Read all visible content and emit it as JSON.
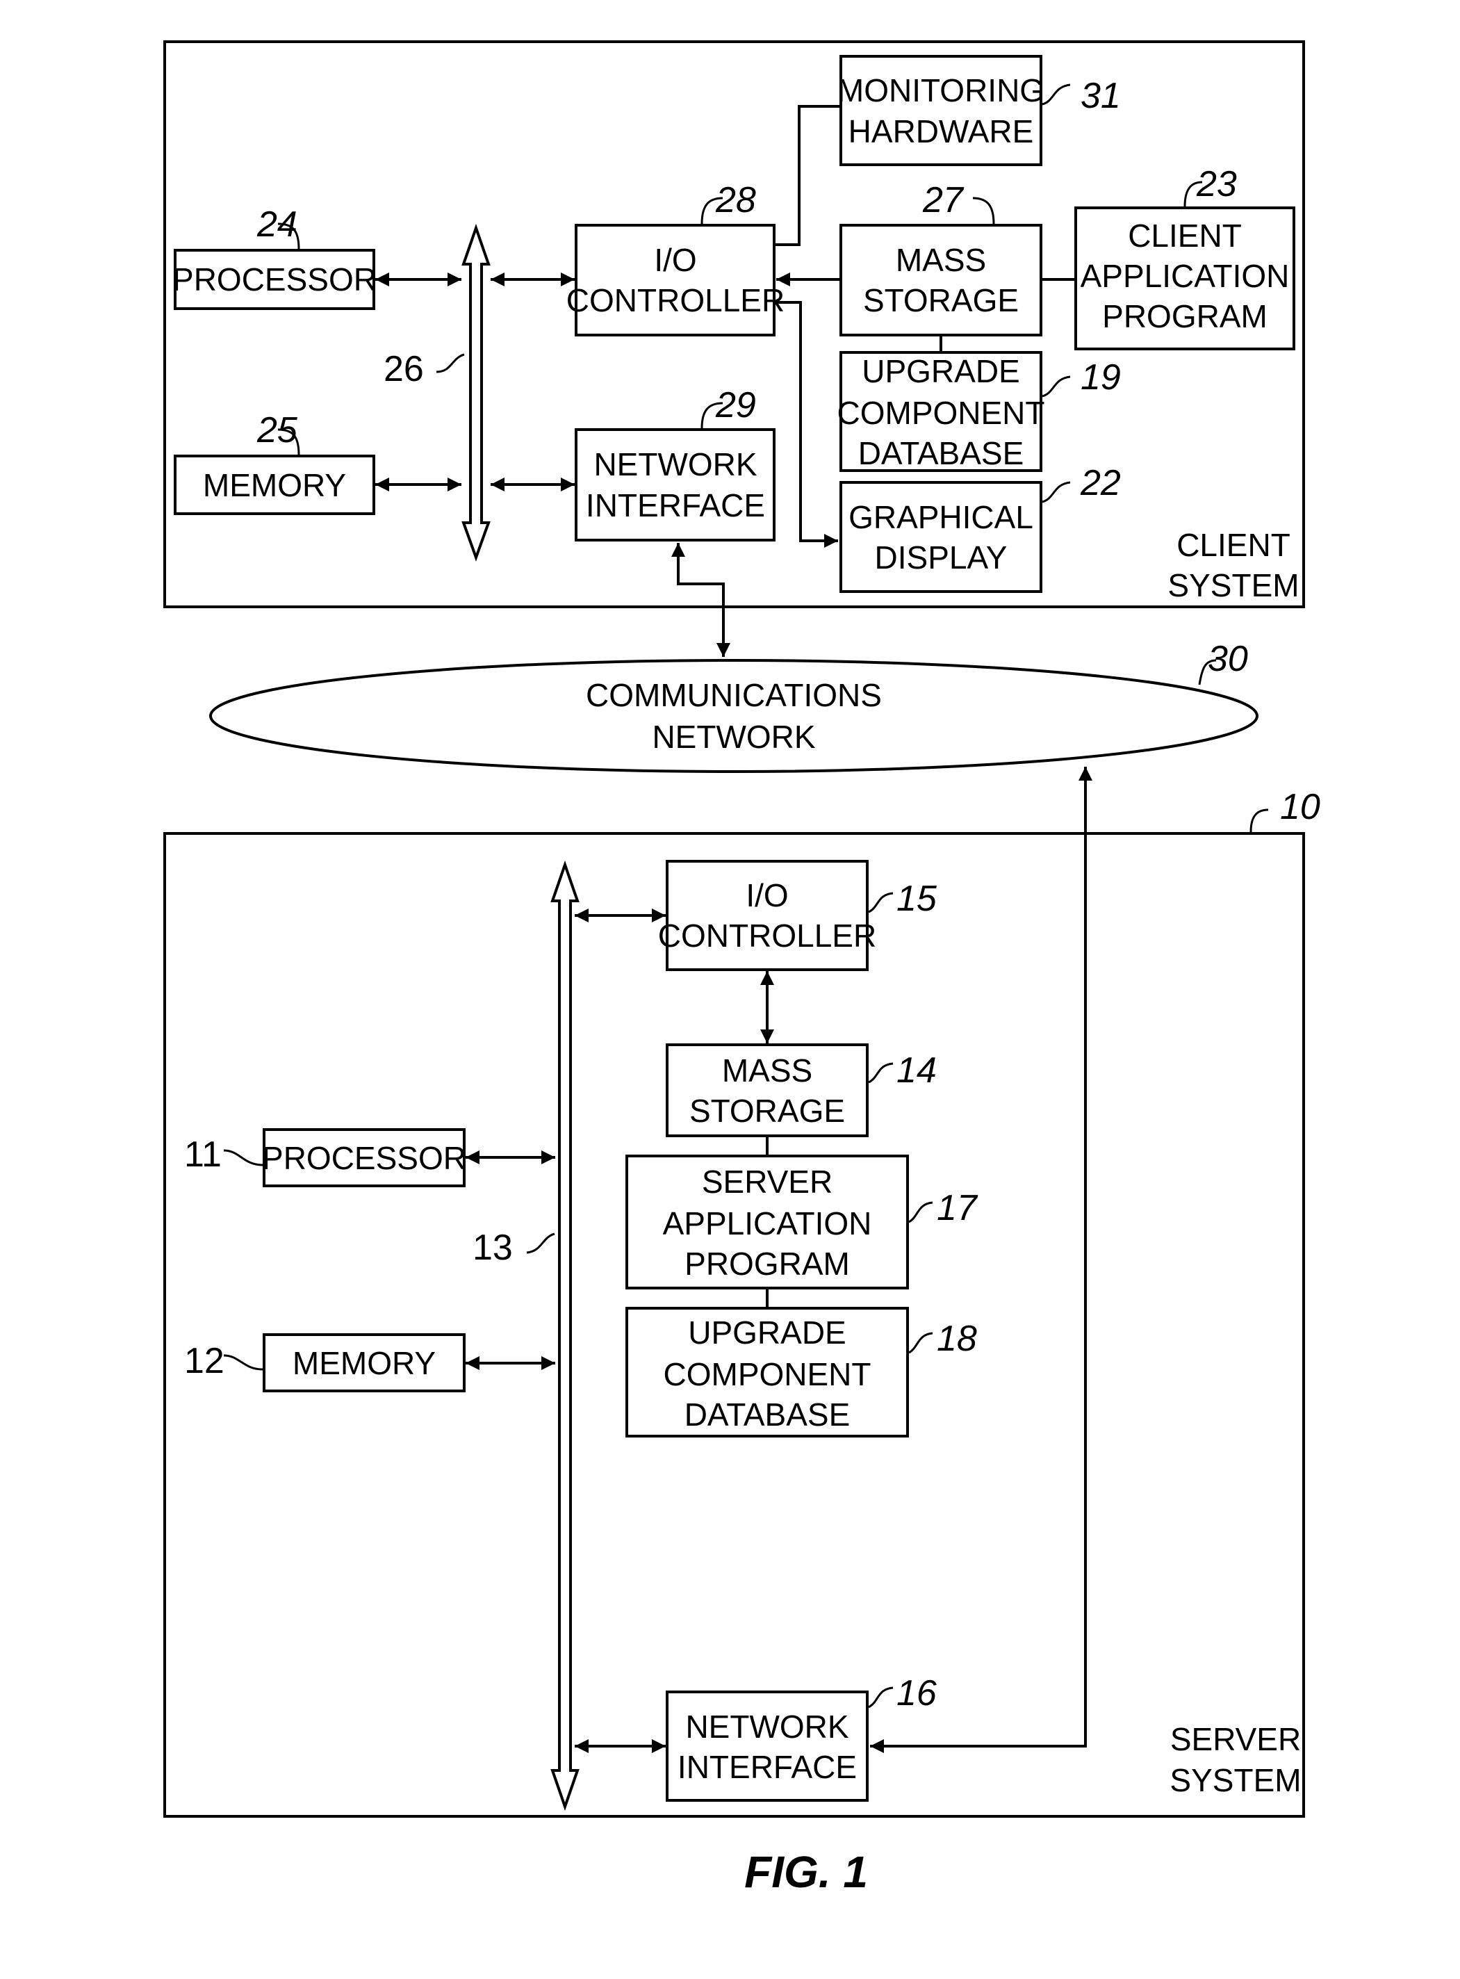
{
  "figure": {
    "caption": "FIG. 1"
  },
  "client_system": {
    "label_line1": "CLIENT",
    "label_line2": "SYSTEM",
    "processor": {
      "lines": [
        "PROCESSOR"
      ],
      "ref": "24"
    },
    "memory": {
      "lines": [
        "MEMORY"
      ],
      "ref": "25"
    },
    "bus": {
      "ref": "26"
    },
    "io_controller": {
      "lines": [
        "I/O",
        "CONTROLLER"
      ],
      "ref": "28"
    },
    "network_interface": {
      "lines": [
        "NETWORK",
        "INTERFACE"
      ],
      "ref": "29"
    },
    "monitoring_hardware": {
      "lines": [
        "MONITORING",
        "HARDWARE"
      ],
      "ref": "31"
    },
    "mass_storage": {
      "lines": [
        "MASS",
        "STORAGE"
      ],
      "ref": "27"
    },
    "client_application_program": {
      "lines": [
        "CLIENT",
        "APPLICATION",
        "PROGRAM"
      ],
      "ref": "23"
    },
    "upgrade_component_database": {
      "lines": [
        "UPGRADE",
        "COMPONENT",
        "DATABASE"
      ],
      "ref": "19"
    },
    "graphical_display": {
      "lines": [
        "GRAPHICAL",
        "DISPLAY"
      ],
      "ref": "22"
    }
  },
  "communications_network": {
    "lines": [
      "COMMUNICATIONS",
      "NETWORK"
    ],
    "ref": "30"
  },
  "server_system": {
    "label_line1": "SERVER",
    "label_line2": "SYSTEM",
    "ref": "10",
    "processor": {
      "lines": [
        "PROCESSOR"
      ],
      "ref": "11"
    },
    "memory": {
      "lines": [
        "MEMORY"
      ],
      "ref": "12"
    },
    "bus": {
      "ref": "13"
    },
    "io_controller": {
      "lines": [
        "I/O",
        "CONTROLLER"
      ],
      "ref": "15"
    },
    "mass_storage": {
      "lines": [
        "MASS",
        "STORAGE"
      ],
      "ref": "14"
    },
    "server_application_program": {
      "lines": [
        "SERVER",
        "APPLICATION",
        "PROGRAM"
      ],
      "ref": "17"
    },
    "upgrade_component_database": {
      "lines": [
        "UPGRADE",
        "COMPONENT",
        "DATABASE"
      ],
      "ref": "18"
    },
    "network_interface": {
      "lines": [
        "NETWORK",
        "INTERFACE"
      ],
      "ref": "16"
    }
  }
}
